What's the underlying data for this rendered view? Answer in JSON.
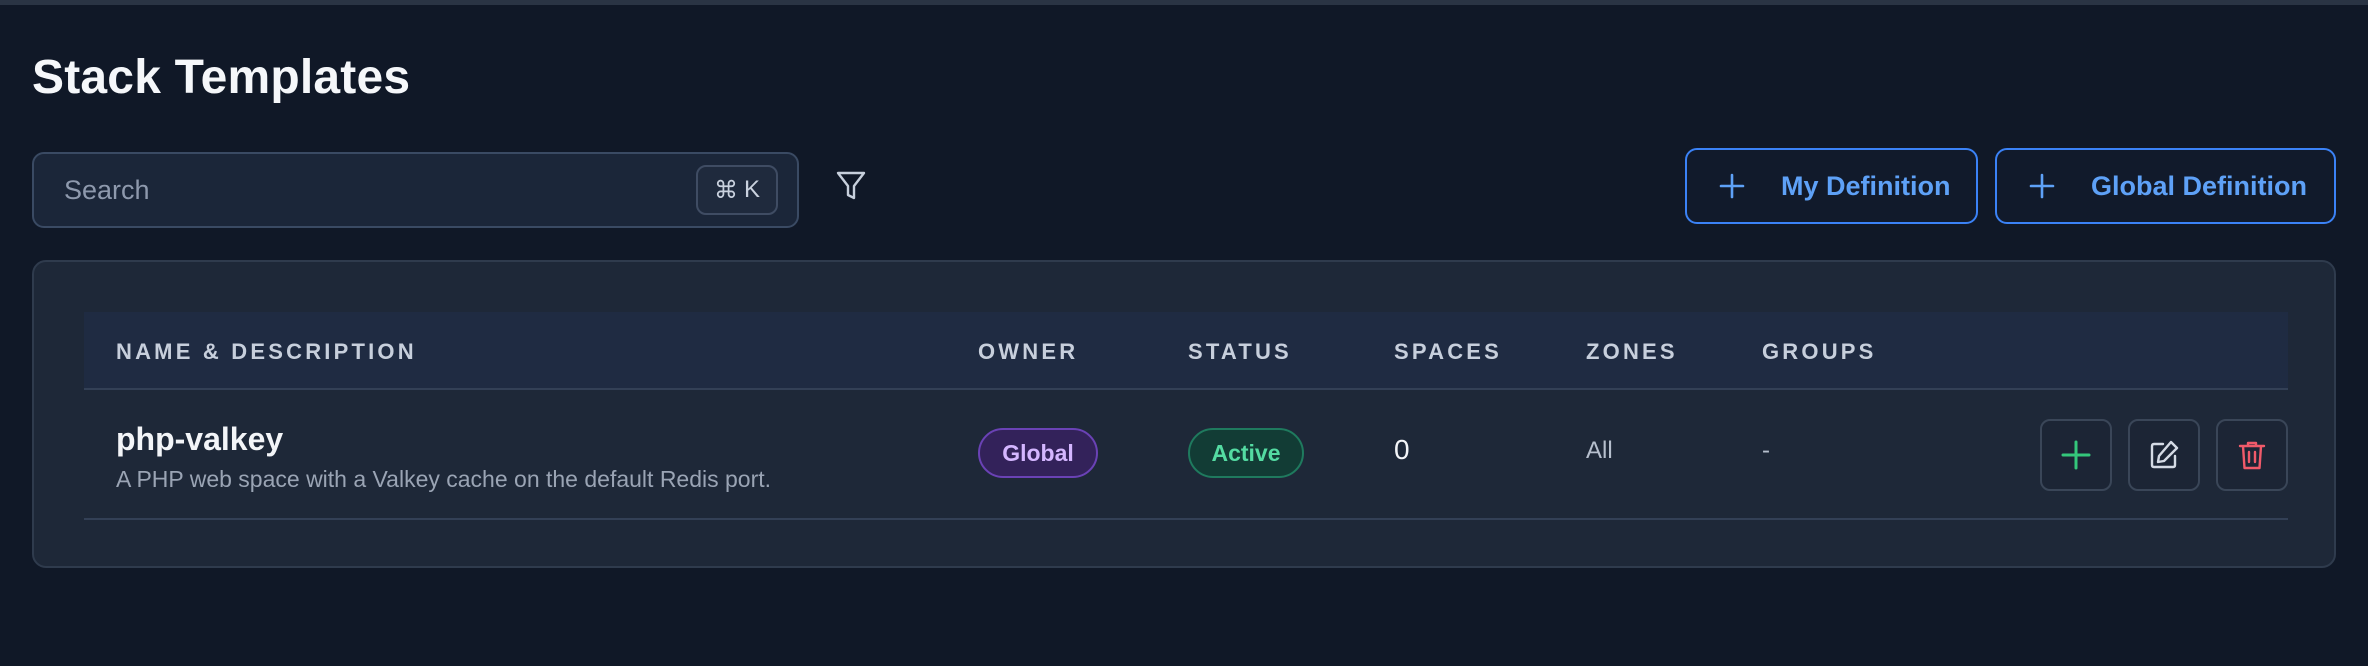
{
  "page": {
    "title": "Stack Templates"
  },
  "search": {
    "placeholder": "Search",
    "shortcut_symbol": "⌘",
    "shortcut_key": "K"
  },
  "toolbar": {
    "my_definition_label": "My Definition",
    "global_definition_label": "Global Definition",
    "accent_color": "#3b82f6"
  },
  "table": {
    "columns": [
      "NAME & DESCRIPTION",
      "OWNER",
      "STATUS",
      "SPACES",
      "ZONES",
      "GROUPS"
    ],
    "rows": [
      {
        "name": "php-valkey",
        "description": "A PHP web space with a Valkey cache on the default Redis port.",
        "owner": "Global",
        "status": "Active",
        "spaces": "0",
        "zones": "All",
        "groups": "-",
        "actions": [
          "plus-icon",
          "edit-icon",
          "trash-icon"
        ]
      }
    ]
  },
  "colors": {
    "background": "#101827",
    "panel": "#1e2838",
    "owner_badge": "#6a42b5",
    "status_active": "#54dba2",
    "delete": "#f05a6a",
    "add": "#34c77b"
  }
}
